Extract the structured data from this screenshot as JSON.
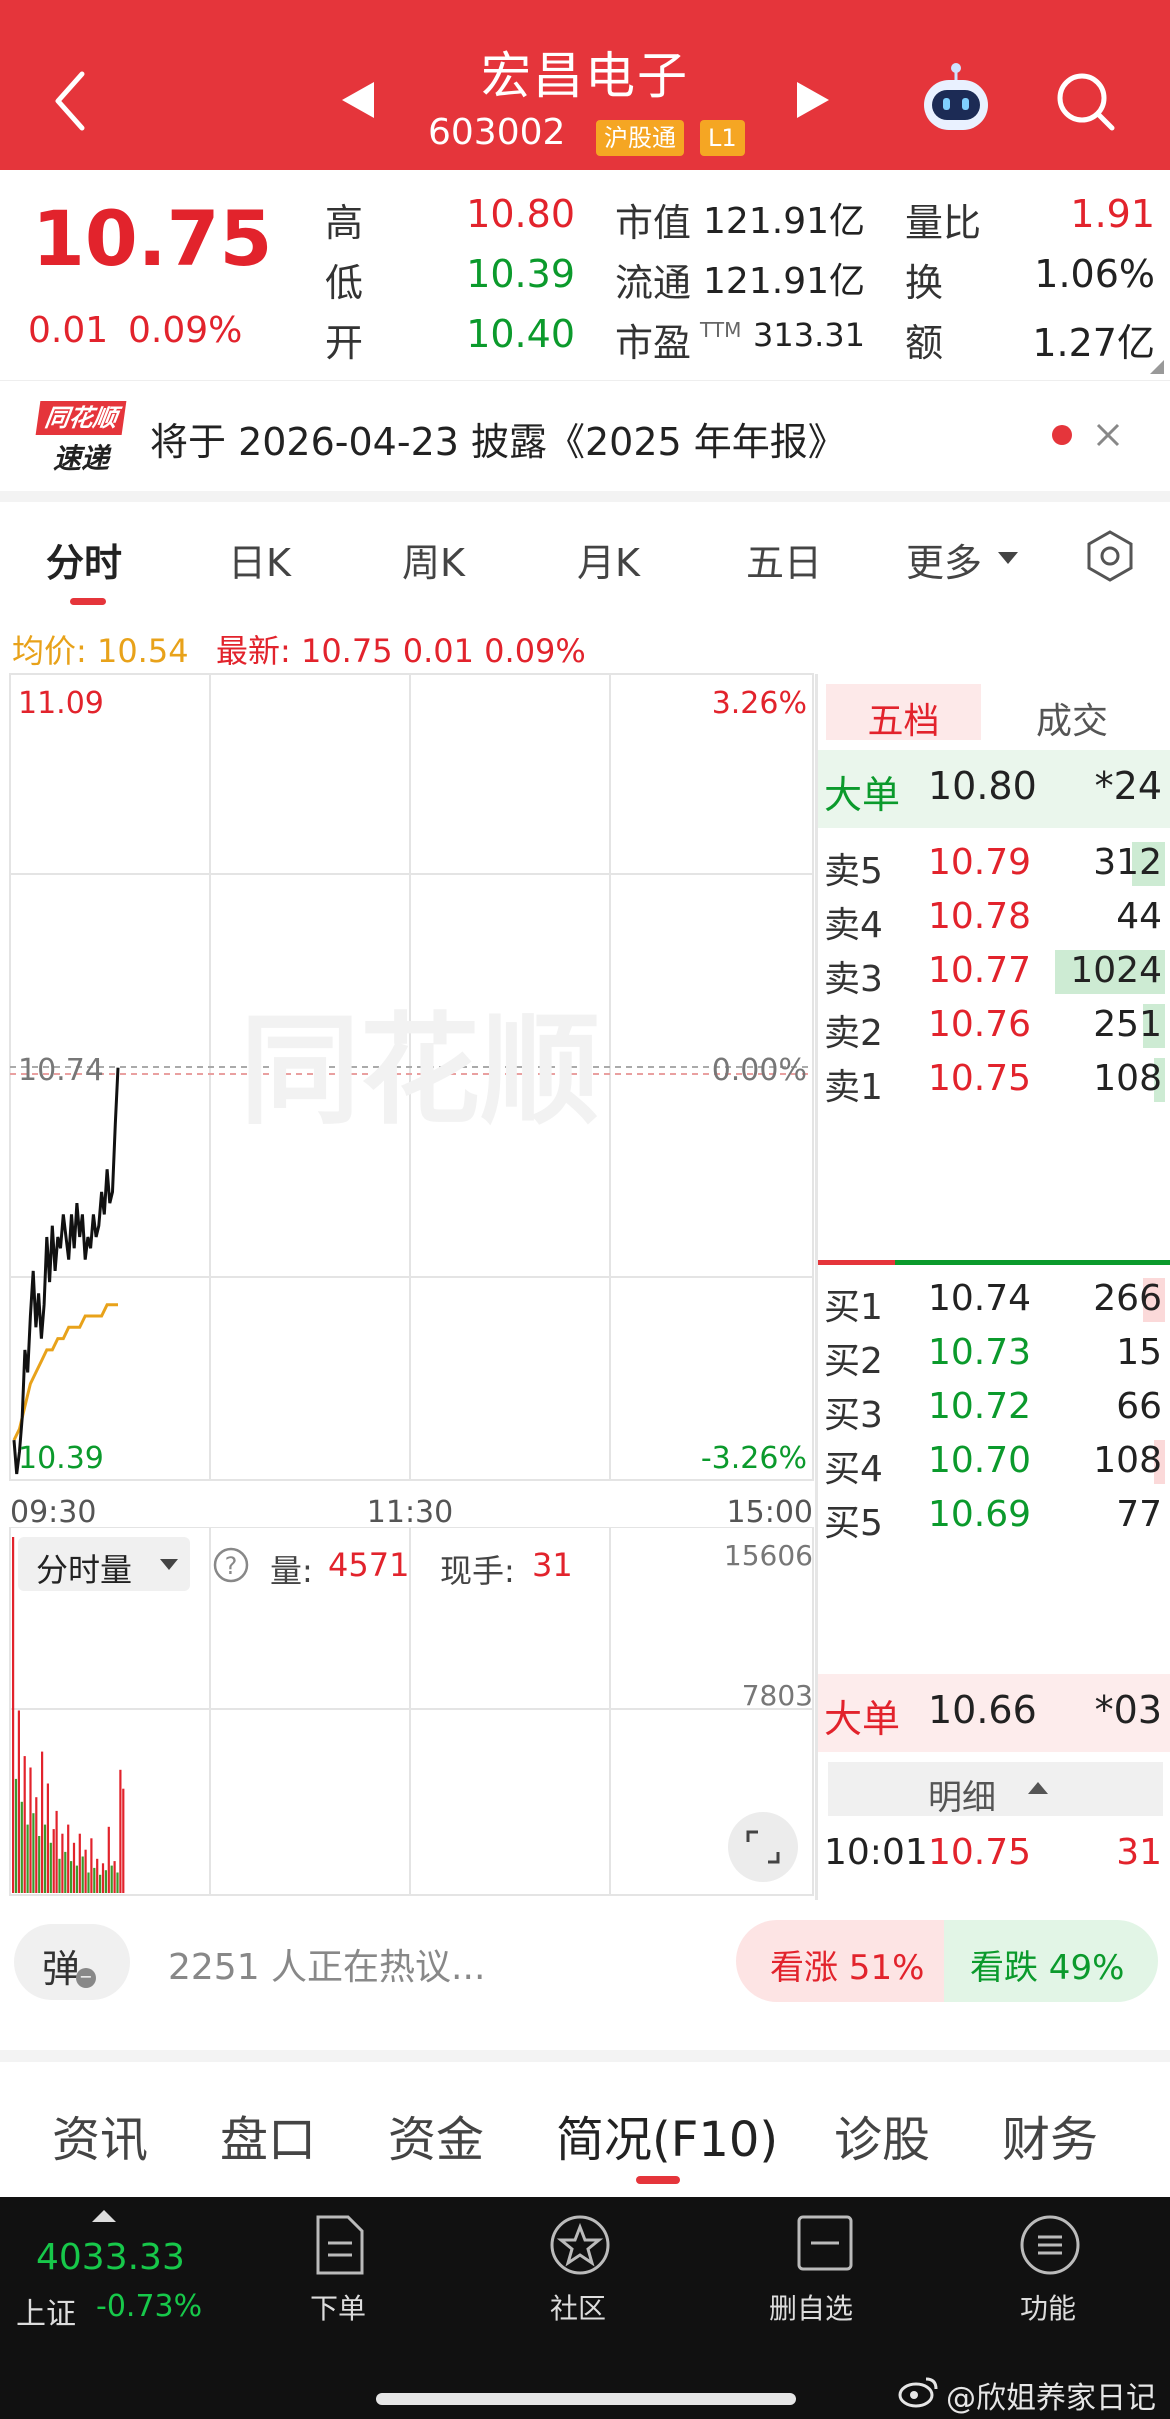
{
  "header": {
    "stock_name": "宏昌电子",
    "stock_code": "603002",
    "tag_hgt": "沪股通",
    "tag_level": "L1"
  },
  "quote": {
    "price": "10.75",
    "change": "0.01",
    "change_pct": "0.09%",
    "high_label": "高",
    "high": "10.80",
    "low_label": "低",
    "low": "10.39",
    "open_label": "开",
    "open": "10.40",
    "mcap_label": "市值",
    "mcap": "121.91亿",
    "float_label": "流通",
    "float": "121.91亿",
    "pe_label": "市盈",
    "pe_sup": "TTM",
    "pe": "313.31",
    "vr_label": "量比",
    "vr": "1.91",
    "turnover_label": "换",
    "turnover": "1.06%",
    "amount_label": "额",
    "amount": "1.27亿"
  },
  "notice": {
    "logo_top": "同花顺",
    "logo_bottom": "速递",
    "text": "将于 2026-04-23 披露《2025 年年报》"
  },
  "tabs": [
    "分时",
    "日K",
    "周K",
    "月K",
    "五日",
    "更多"
  ],
  "legend": {
    "avg_label": "均价: 10.54",
    "latest": "最新: 10.75  0.01  0.09%"
  },
  "chart_data": {
    "type": "line",
    "y_max_label": "11.09",
    "y_mid_label": "10.74",
    "y_min_label": "10.39",
    "pct_max_label": "3.26%",
    "pct_mid_label": "0.00%",
    "pct_min_label": "-3.26%",
    "x_labels": [
      "09:30",
      "11:30",
      "15:00"
    ],
    "ylim": [
      10.39,
      11.09
    ],
    "watermark": "同花顺",
    "series": [
      {
        "values": [
          10.42,
          10.39,
          10.41,
          10.44,
          10.5,
          10.48,
          10.53,
          10.57,
          10.52,
          10.55,
          10.51,
          10.54,
          10.6,
          10.56,
          10.61,
          10.57,
          10.6,
          10.59,
          10.62,
          10.6,
          10.58,
          10.62,
          10.59,
          10.63,
          10.6,
          10.62,
          10.58,
          10.6,
          10.59,
          10.62,
          10.6,
          10.61,
          10.64,
          10.62,
          10.66,
          10.63,
          10.64,
          10.7,
          10.75
        ]
      },
      {
        "values": [
          10.42,
          10.43,
          10.45,
          10.47,
          10.48,
          10.49,
          10.5,
          10.5,
          10.51,
          10.51,
          10.52,
          10.52,
          10.52,
          10.53,
          10.53,
          10.53,
          10.53,
          10.54,
          10.54,
          10.54
        ]
      }
    ],
    "volume": {
      "max_label": "15606",
      "mid_label": "7803",
      "values": [
        15606,
        5000,
        8000,
        4000,
        6000,
        3000,
        5500,
        3500,
        4200,
        2500,
        6200,
        3000,
        4800,
        2200,
        2800,
        3600,
        1500,
        2600,
        1800,
        3000,
        1400,
        2200,
        1200,
        2600,
        1600,
        1900,
        900,
        2400,
        1100,
        1500,
        800,
        1300,
        1000,
        2900,
        1200,
        1400,
        900,
        5400,
        4571
      ],
      "colors": [
        "red",
        "green",
        "red",
        "green",
        "red",
        "green",
        "red",
        "green",
        "red",
        "green",
        "red",
        "green",
        "red",
        "green",
        "red",
        "red",
        "green",
        "red",
        "green",
        "red",
        "green",
        "red",
        "green",
        "red",
        "green",
        "red",
        "green",
        "red",
        "green",
        "red",
        "green",
        "red",
        "green",
        "red",
        "green",
        "red",
        "green",
        "red",
        "red"
      ]
    }
  },
  "volume_panel": {
    "selector": "分时量",
    "vol_label": "量: ",
    "vol_value": "4571",
    "cur_label": "现手: ",
    "cur_value": "31"
  },
  "orderbook": {
    "tab_active": "五档",
    "tab_trade": "成交",
    "big_sell": {
      "label": "大单",
      "price": "10.80",
      "vol": "*24"
    },
    "asks": [
      {
        "label": "卖5",
        "price": "10.79",
        "vol": "312",
        "bar": 0.3
      },
      {
        "label": "卖4",
        "price": "10.78",
        "vol": "44",
        "bar": 0
      },
      {
        "label": "卖3",
        "price": "10.77",
        "vol": "1024",
        "bar": 1.0
      },
      {
        "label": "卖2",
        "price": "10.76",
        "vol": "251",
        "bar": 0.2
      },
      {
        "label": "卖1",
        "price": "10.75",
        "vol": "108",
        "bar": 0.1
      }
    ],
    "bids": [
      {
        "label": "买1",
        "price": "10.74",
        "vol": "266",
        "bar": 0.2
      },
      {
        "label": "买2",
        "price": "10.73",
        "vol": "15",
        "bar": 0
      },
      {
        "label": "买3",
        "price": "10.72",
        "vol": "66",
        "bar": 0
      },
      {
        "label": "买4",
        "price": "10.70",
        "vol": "108",
        "bar": 0.1
      },
      {
        "label": "买5",
        "price": "10.69",
        "vol": "77",
        "bar": 0
      }
    ],
    "big_buy": {
      "label": "大单",
      "price": "10.66",
      "vol": "*03"
    },
    "detail_label": "明细",
    "detail": {
      "time": "10:01",
      "price": "10.75",
      "vol": "31"
    }
  },
  "discussion": {
    "danmu": "弹",
    "text": "2251 人正在热议...",
    "up": "看涨 51%",
    "down": "看跌 49%"
  },
  "bottom_tabs": [
    "资讯",
    "盘口",
    "资金",
    "简况(F10)",
    "诊股",
    "财务"
  ],
  "footer": {
    "index_value": "4033.33",
    "index_name": "上证",
    "index_change": "-0.73%",
    "items": [
      "下单",
      "社区",
      "删自选",
      "功能"
    ],
    "watermark": "@欣姐养家日记"
  }
}
